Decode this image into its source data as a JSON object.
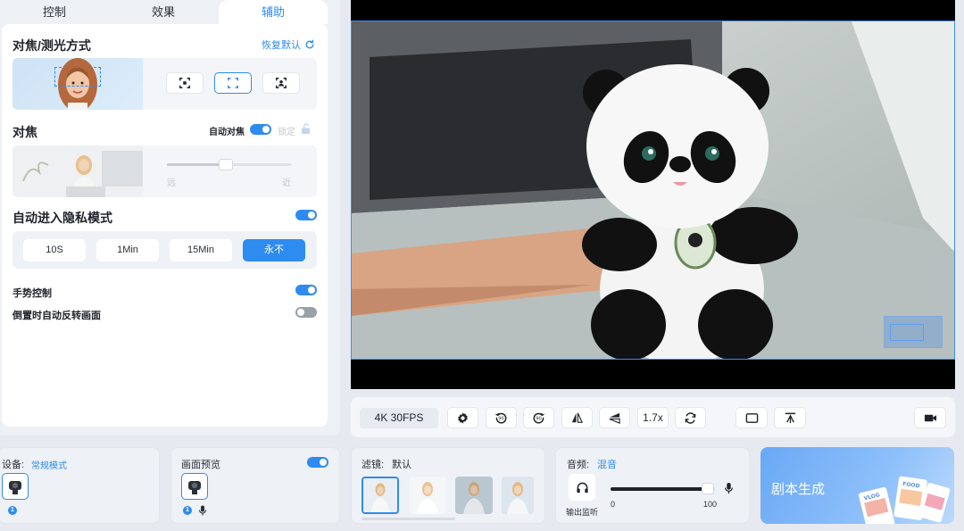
{
  "tabs": [
    {
      "label": "控制",
      "active": false
    },
    {
      "label": "效果",
      "active": false
    },
    {
      "label": "辅助",
      "active": true
    }
  ],
  "focus_metering": {
    "title": "对焦/测光方式",
    "restore_label": "恢复默认"
  },
  "focus": {
    "title": "对焦",
    "auto_focus_label": "自动对焦",
    "auto_focus_on": true,
    "lock_label": "锁定",
    "near_label": "远",
    "far_label": "近",
    "level": 0.47
  },
  "privacy": {
    "title": "自动进入隐私模式",
    "enabled": true,
    "options": [
      "10S",
      "1Min",
      "15Min",
      "永不"
    ],
    "selected": "永不"
  },
  "gesture_control": {
    "label": "手势控制",
    "enabled": true
  },
  "invert_flip": {
    "label": "倒置时自动反转画面",
    "enabled": false
  },
  "control_bar": {
    "resolution": "4K 30FPS",
    "zoom": "1.7x"
  },
  "device": {
    "label": "设备:",
    "mode": "常规模式",
    "badge": "1"
  },
  "preview": {
    "label": "画面预览",
    "enabled": true,
    "badge": "1"
  },
  "filter": {
    "label": "滤镜:",
    "value": "默认"
  },
  "audio": {
    "label": "音频:",
    "value": "混音",
    "monitor_label": "输出监听",
    "min": "0",
    "max": "100",
    "level": 0.93
  },
  "script": {
    "title": "剧本生成"
  },
  "colors": {
    "accent": "#2e8bf0",
    "panel_bg": "#edf1f6"
  }
}
